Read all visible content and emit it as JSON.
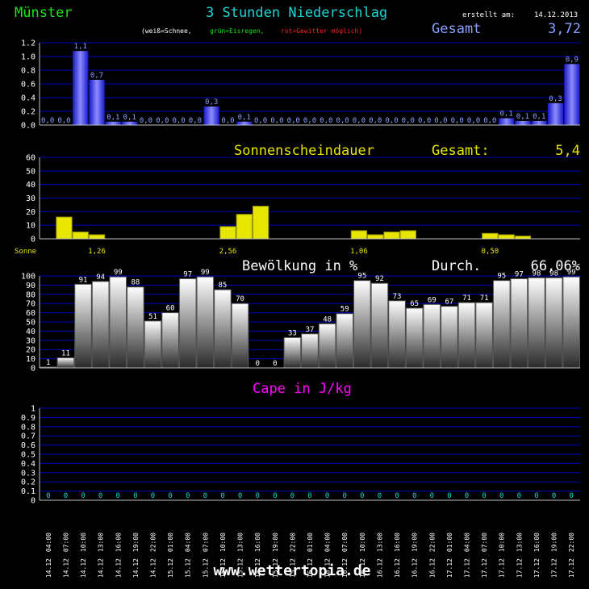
{
  "header": {
    "location": "Münster",
    "title": "3 Stunden Niederschlag",
    "created_label": "erstellt am:",
    "created_date": "14.12.2013",
    "legend_white": "(weiß=Schnee,",
    "legend_green": "grün=Eisregen,",
    "legend_red": "rot=Gewitter möglich)",
    "total_label": "Gesamt",
    "total_value": "3,72"
  },
  "footer": {
    "site": "www.wettertopia.de"
  },
  "time_labels": [
    [
      "14.12",
      "04:00"
    ],
    [
      "14.12",
      "07:00"
    ],
    [
      "14.12",
      "10:00"
    ],
    [
      "14.12",
      "13:00"
    ],
    [
      "14.12",
      "16:00"
    ],
    [
      "14.12",
      "19:00"
    ],
    [
      "14.12",
      "22:00"
    ],
    [
      "15.12",
      "01:00"
    ],
    [
      "15.12",
      "04:00"
    ],
    [
      "15.12",
      "07:00"
    ],
    [
      "15.12",
      "10:00"
    ],
    [
      "15.12",
      "13:00"
    ],
    [
      "15.12",
      "16:00"
    ],
    [
      "15.12",
      "19:00"
    ],
    [
      "15.12",
      "22:00"
    ],
    [
      "16.12",
      "01:00"
    ],
    [
      "16.12",
      "04:00"
    ],
    [
      "16.12",
      "07:00"
    ],
    [
      "16.12",
      "10:00"
    ],
    [
      "16.12",
      "13:00"
    ],
    [
      "16.12",
      "16:00"
    ],
    [
      "16.12",
      "19:00"
    ],
    [
      "16.12",
      "22:00"
    ],
    [
      "17.12",
      "01:00"
    ],
    [
      "17.12",
      "04:00"
    ],
    [
      "17.12",
      "07:00"
    ],
    [
      "17.12",
      "10:00"
    ],
    [
      "17.12",
      "13:00"
    ],
    [
      "17.12",
      "16:00"
    ],
    [
      "17.12",
      "19:00"
    ],
    [
      "17.12",
      "22:00"
    ]
  ],
  "colors": {
    "grid": "#0000c0",
    "axis": "#c0c0c0",
    "precip": "#3a3aff",
    "sun": "#e6e600",
    "cloud_top": "#ffffff",
    "cape_title": "#ff00ff",
    "cyan": "#19d5d5",
    "green": "#19e619",
    "red": "#ff2020",
    "blue_label": "#8aa2ff"
  },
  "chart_data": [
    {
      "type": "bar",
      "name": "precipitation",
      "ylim": [
        0,
        1.2
      ],
      "yticks": [
        "0.0",
        "0.2",
        "0.4",
        "0.6",
        "0.8",
        "1.0",
        "1.2"
      ],
      "values": [
        0,
        0,
        1.08,
        0.66,
        0.05,
        0.05,
        0,
        0,
        0,
        0,
        0.27,
        0,
        0.05,
        0,
        0,
        0,
        0,
        0,
        0,
        0,
        0,
        0,
        0,
        0,
        0,
        0,
        0,
        0,
        0.1,
        0.06,
        0.06,
        0.32,
        0.89
      ],
      "labels": [
        "0,0",
        "0,0",
        "1,1",
        "0,7",
        "0,1",
        "0,1",
        "0,0",
        "0,0",
        "0,0",
        "0,0",
        "0,3",
        "0,0",
        "0,1",
        "0,0",
        "0,0",
        "0,0",
        "0,0",
        "0,0",
        "0,0",
        "0,0",
        "0,0",
        "0,0",
        "0,0",
        "0,0",
        "0,0",
        "0,0",
        "0,0",
        "0,0",
        "0,1",
        "0,1",
        "0,1",
        "0,3",
        "0,9"
      ]
    },
    {
      "type": "bar",
      "name": "sunshine",
      "title": "Sonnenscheindauer",
      "total_label": "Gesamt:",
      "total_value": "5,4",
      "row_label": "Sonne",
      "ylim": [
        0,
        60
      ],
      "yticks": [
        "0",
        "10",
        "20",
        "30",
        "40",
        "50",
        "60"
      ],
      "values": [
        0,
        16,
        5,
        3,
        0,
        0,
        0,
        0,
        0,
        0,
        0,
        9,
        18,
        24,
        0,
        0,
        0,
        0,
        0,
        6,
        3,
        5,
        6,
        0,
        0,
        0,
        0,
        4,
        3,
        2,
        0,
        0,
        0
      ],
      "day_totals": [
        {
          "label": "1,26",
          "at": 3
        },
        {
          "label": "2,56",
          "at": 11
        },
        {
          "label": "1,06",
          "at": 19
        },
        {
          "label": "0,50",
          "at": 27
        }
      ]
    },
    {
      "type": "bar",
      "name": "cloud_cover",
      "title": "Bewölkung in %",
      "avg_label": "Durch.",
      "avg_value": "66,06%",
      "ylim": [
        0,
        100
      ],
      "yticks": [
        "0",
        "10",
        "20",
        "30",
        "40",
        "50",
        "60",
        "70",
        "80",
        "90",
        "100"
      ],
      "values": [
        1,
        11,
        91,
        94,
        99,
        88,
        51,
        60,
        97,
        99,
        85,
        70,
        0,
        0,
        33,
        37,
        48,
        59,
        95,
        92,
        73,
        65,
        69,
        67,
        71,
        71,
        95,
        97,
        98,
        98,
        99
      ],
      "labels": [
        "1",
        "11",
        "91",
        "94",
        "99",
        "88",
        "51",
        "60",
        "97",
        "99",
        "85",
        "70",
        "0",
        "0",
        "33",
        "37",
        "48",
        "59",
        "95",
        "92",
        "73",
        "65",
        "69",
        "67",
        "71",
        "71",
        "95",
        "97",
        "98",
        "98",
        "99"
      ]
    },
    {
      "type": "bar",
      "name": "cape",
      "title": "Cape in J/kg",
      "ylim": [
        0,
        1
      ],
      "yticks": [
        "0",
        "0.1",
        "0.2",
        "0.3",
        "0.4",
        "0.5",
        "0.6",
        "0.7",
        "0.8",
        "0.9",
        "1"
      ],
      "values": [
        0,
        0,
        0,
        0,
        0,
        0,
        0,
        0,
        0,
        0,
        0,
        0,
        0,
        0,
        0,
        0,
        0,
        0,
        0,
        0,
        0,
        0,
        0,
        0,
        0,
        0,
        0,
        0,
        0,
        0,
        0
      ],
      "labels": [
        "0",
        "0",
        "0",
        "0",
        "0",
        "0",
        "0",
        "0",
        "0",
        "0",
        "0",
        "0",
        "0",
        "0",
        "0",
        "0",
        "0",
        "0",
        "0",
        "0",
        "0",
        "0",
        "0",
        "0",
        "0",
        "0",
        "0",
        "0",
        "0",
        "0",
        "0"
      ]
    }
  ]
}
